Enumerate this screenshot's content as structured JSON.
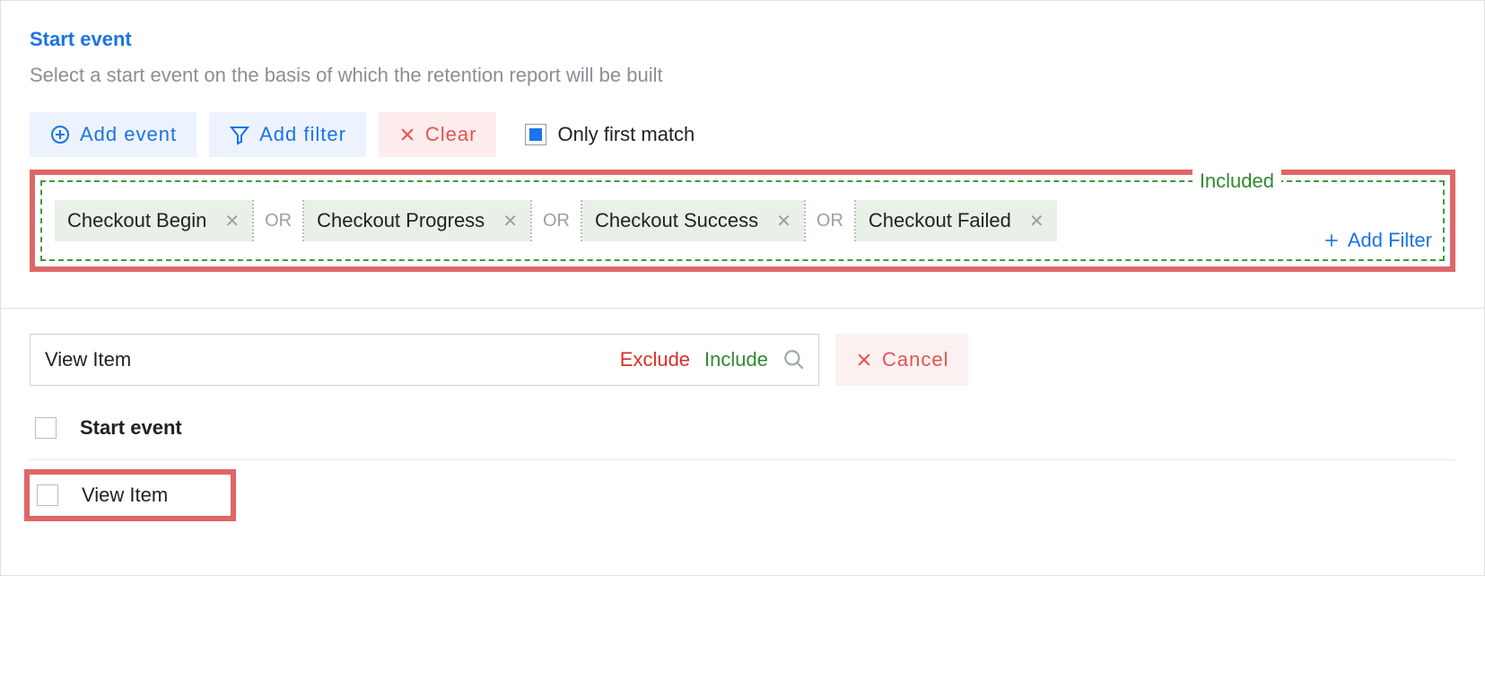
{
  "top": {
    "title": "Start event",
    "subtitle": "Select a start event on the basis of which the retention report will be built",
    "buttons": {
      "add_event": "Add event",
      "add_filter": "Add filter",
      "clear": "Clear"
    },
    "only_first_label": "Only first match"
  },
  "included": {
    "legend": "Included",
    "or": "OR",
    "events": [
      "Checkout Begin",
      "Checkout Progress",
      "Checkout Success",
      "Checkout Failed"
    ],
    "add_filter": "Add Filter"
  },
  "search": {
    "value": "View Item",
    "exclude": "Exclude",
    "include": "Include",
    "cancel": "Cancel"
  },
  "results": {
    "group_label": "Start event",
    "item": "View Item"
  }
}
